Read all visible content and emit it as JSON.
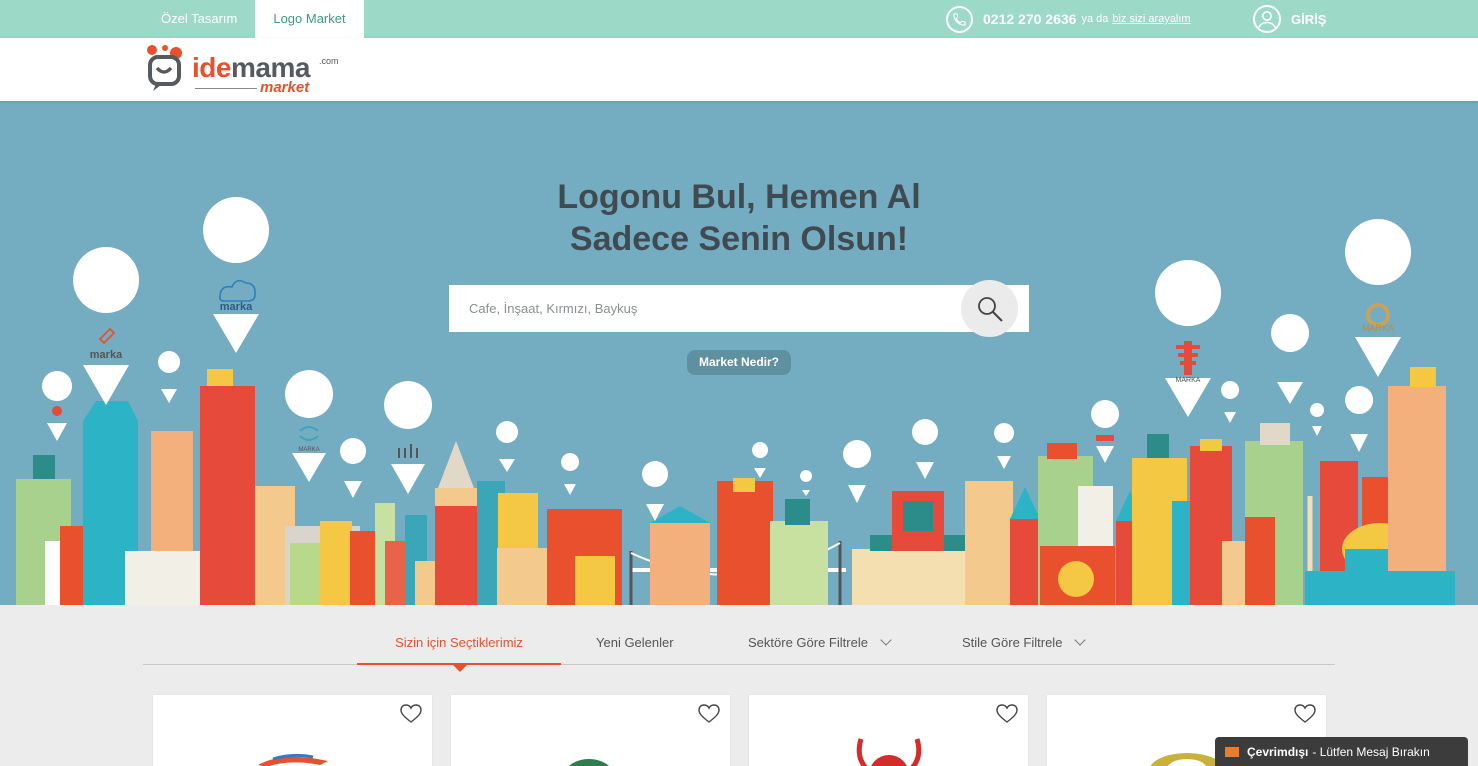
{
  "topbar": {
    "tabs": [
      {
        "label": "Özel Tasarım",
        "active": false
      },
      {
        "label": "Logo Market",
        "active": true
      }
    ],
    "phone": "0212 270 2636",
    "or_text": "ya da",
    "callback": "biz sizi arayalım",
    "login": "GİRİŞ"
  },
  "logo": {
    "part1": "ide",
    "part2": "mama",
    "com": ".com",
    "sub": "market"
  },
  "hero": {
    "title_line1": "Logonu Bul, Hemen Al",
    "title_line2": "Sadece Senin Olsun!",
    "search_placeholder": "Cafe, İnşaat, Kırmızı, Baykuş",
    "market_button": "Market Nedir?",
    "pin_labels": [
      "marka",
      "marka",
      "MARKA",
      "MARKA",
      "MARKA"
    ]
  },
  "tabs": {
    "picks": "Sizin için Seçtiklerimiz",
    "new": "Yeni Gelenler",
    "sector": "Sektöre Göre Filtrele",
    "style": "Stile Göre Filtrele"
  },
  "cards": [
    {
      "name": "card-1"
    },
    {
      "name": "card-2"
    },
    {
      "name": "card-3"
    },
    {
      "name": "card-4"
    }
  ],
  "chat": {
    "status": "Çevrimdışı",
    "message": "- Lütfen Mesaj Bırakın"
  },
  "colors": {
    "accent": "#e8502e",
    "topbar": "#9cd9c6",
    "sky": "#74adc1"
  }
}
